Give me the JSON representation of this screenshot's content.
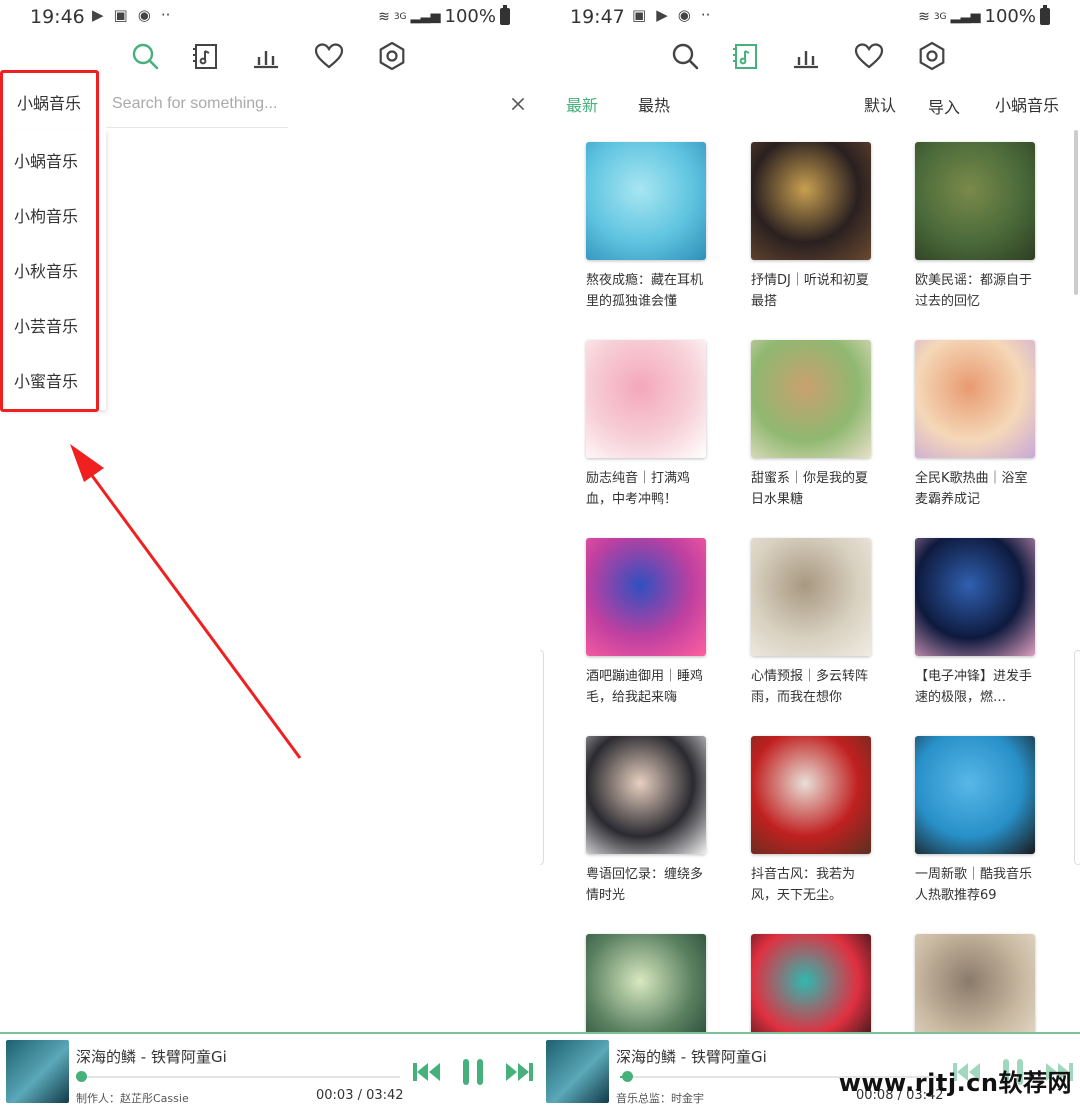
{
  "left": {
    "status": {
      "time": "19:46",
      "battery": "100%",
      "network": "3G"
    },
    "source_current": "小蜗音乐",
    "search_placeholder": "Search for something...",
    "source_options": [
      "小蜗音乐",
      "小枸音乐",
      "小秋音乐",
      "小芸音乐",
      "小蜜音乐"
    ],
    "player": {
      "title": "深海的鳞 - 铁臂阿童Gi",
      "credit": "制作人：赵芷彤Cassie",
      "time": "00:03 / 03:42",
      "progress": 0.014
    }
  },
  "right": {
    "status": {
      "time": "19:47",
      "battery": "100%",
      "network": "3G"
    },
    "tabs": {
      "latest": "最新",
      "hottest": "最热",
      "default": "默认",
      "import": "导入",
      "source": "小蜗音乐"
    },
    "playlists": [
      {
        "title": "熬夜成瘾：藏在耳机里的孤独谁会懂",
        "cover": [
          "#5fc4e0",
          "#a8e6f2",
          "#2d8fb8"
        ]
      },
      {
        "title": "抒情DJ｜听说和初夏最搭",
        "cover": [
          "#2a2020",
          "#c9a050",
          "#6a4a30"
        ]
      },
      {
        "title": "欧美民谣：都源自于过去的回忆",
        "cover": [
          "#4a6a3a",
          "#7a8a4a",
          "#2e3e22"
        ]
      },
      {
        "title": "励志纯音｜打满鸡血，中考冲鸭！",
        "cover": [
          "#f7d0d8",
          "#f4a7b9",
          "#ffffff"
        ]
      },
      {
        "title": "甜蜜系｜你是我的夏日水果糖",
        "cover": [
          "#8fb870",
          "#c9a070",
          "#e8e0c8"
        ]
      },
      {
        "title": "全民K歌热曲｜浴室麦霸养成记",
        "cover": [
          "#f5d8b8",
          "#e89a70",
          "#c8a8d8"
        ]
      },
      {
        "title": "酒吧蹦迪御用｜睡鸡毛，给我起来嗨",
        "cover": [
          "#c040a0",
          "#3050c0",
          "#ff60a0"
        ]
      },
      {
        "title": "心情预报｜多云转阵雨，而我在想你",
        "cover": [
          "#d8d0c0",
          "#a89880",
          "#f0ece4"
        ]
      },
      {
        "title": "【电子冲锋】进发手速的极限，燃…",
        "cover": [
          "#0e1a3e",
          "#3060b0",
          "#e0a0c0"
        ]
      },
      {
        "title": "粤语回忆录：缠绕多情时光",
        "cover": [
          "#2a2a30",
          "#e8d0c0",
          "#f0f0f0"
        ]
      },
      {
        "title": "抖音古风：我若为风，天下无尘。",
        "cover": [
          "#c02020",
          "#e8e0d8",
          "#5a3020"
        ]
      },
      {
        "title": "一周新歌｜酷我音乐人热歌推荐69",
        "cover": [
          "#2890c8",
          "#58b8e8",
          "#1a1a1a"
        ]
      },
      {
        "title": "",
        "cover": [
          "#5a8060",
          "#d8e8c0",
          "#204030"
        ]
      },
      {
        "title": "",
        "cover": [
          "#e03040",
          "#30b8b0",
          "#101010"
        ]
      },
      {
        "title": "",
        "cover": [
          "#c8b8a0",
          "#8a7a6a",
          "#e8e0d0"
        ]
      }
    ],
    "player": {
      "title": "深海的鳞 - 铁臂阿童Gi",
      "credit": "音乐总监：时金宇",
      "time": "00:08 / 03:42",
      "progress": 0.038
    },
    "watermark": "www.rjtj.cn软荐网"
  },
  "colors": {
    "accent": "#46b17b",
    "highlight": "#f02020",
    "text": "#333333"
  },
  "icons": [
    "search-icon",
    "music-file-icon",
    "chart-bars-icon",
    "heart-icon",
    "hexagon-settings-icon",
    "close-icon",
    "previous-icon",
    "pause-icon",
    "next-icon"
  ]
}
